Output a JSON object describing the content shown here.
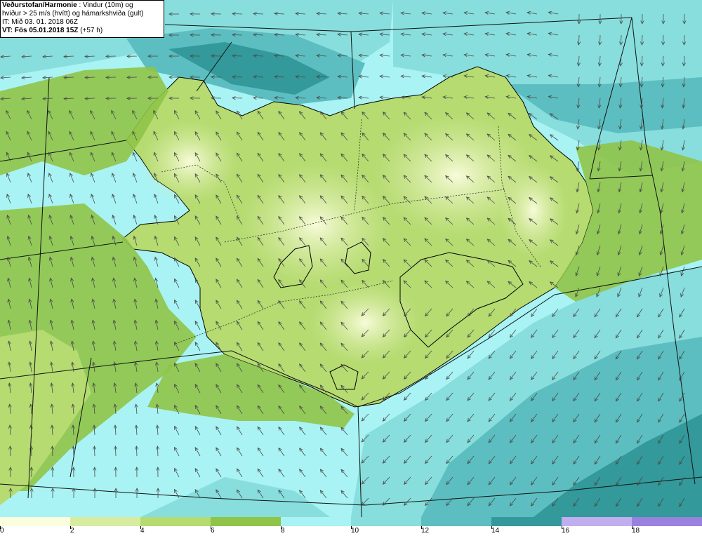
{
  "header": {
    "source": "Veðurstofan/Harmonie",
    "title_rest": ": Vindur (10m) og",
    "line2": "hviður > 25 m/s (hvítt) og hámarkshviða (gult)",
    "line3": "IT: Mið 03. 01. 2018 06Z",
    "line4": "VT: Fös 05.01.2018 15Z",
    "line4_suffix": "(+57 h)"
  },
  "legend": {
    "bins": [
      {
        "from": 0,
        "to": 2,
        "color": "#fbfddf"
      },
      {
        "from": 2,
        "to": 4,
        "color": "#d8ec9f"
      },
      {
        "from": 4,
        "to": 6,
        "color": "#b5db71"
      },
      {
        "from": 6,
        "to": 8,
        "color": "#8fc448"
      },
      {
        "from": 8,
        "to": 10,
        "color": "#a9f3f4"
      },
      {
        "from": 10,
        "to": 12,
        "color": "#87dedd"
      },
      {
        "from": 12,
        "to": 14,
        "color": "#5cbec0"
      },
      {
        "from": 14,
        "to": 16,
        "color": "#33999a"
      },
      {
        "from": 16,
        "to": 18,
        "color": "#c0aeee"
      },
      {
        "from": 18,
        "to": 20,
        "color": "#9a80df"
      }
    ],
    "ticks": [
      "0",
      "2",
      "4",
      "6",
      "8",
      "10",
      "12",
      "14",
      "16",
      "18"
    ]
  }
}
